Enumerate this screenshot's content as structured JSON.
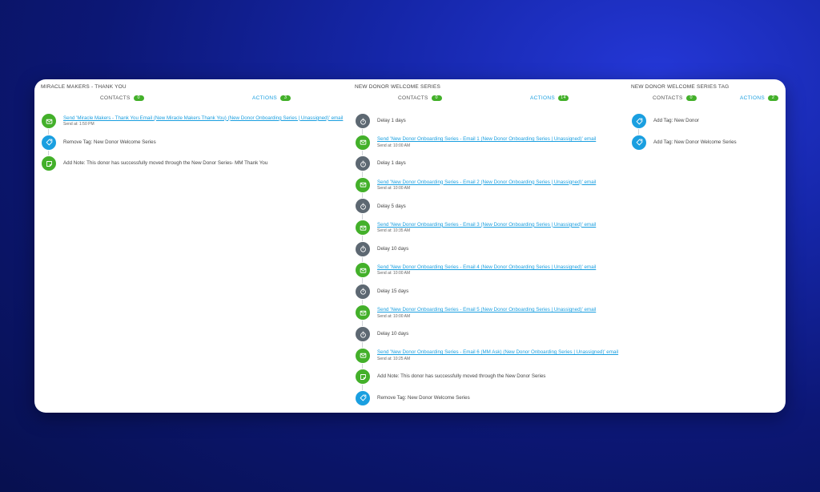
{
  "columns": [
    {
      "title": "MIRACLE MAKERS - THANK YOU",
      "contacts_label": "CONTACTS",
      "contacts_count": "0",
      "actions_label": "ACTIONS",
      "actions_count": "3",
      "steps": [
        {
          "type": "email",
          "icon": "envelope-icon",
          "text": "Send 'Miracle Makers - Thank You Email (New Miracle Makers Thank You) (New Donor Onboarding Series | Unassigned)' email",
          "sub": "Send at: 1:50 PM"
        },
        {
          "type": "tag",
          "icon": "tag-icon",
          "text": "Remove Tag: New Donor Welcome Series"
        },
        {
          "type": "note",
          "icon": "note-icon",
          "text": "Add Note: This donor has successfully moved through the New Donor Series- MM Thank You"
        }
      ]
    },
    {
      "title": "NEW DONOR WELCOME SERIES",
      "contacts_label": "CONTACTS",
      "contacts_count": "0",
      "actions_label": "ACTIONS",
      "actions_count": "14",
      "steps": [
        {
          "type": "delay",
          "icon": "stopwatch-icon",
          "text": "Delay 1 days"
        },
        {
          "type": "email",
          "icon": "envelope-icon",
          "text": "Send 'New Donor Onboarding Series - Email 1 (New Donor Onboarding Series | Unassigned)' email",
          "sub": "Send at: 10:00 AM"
        },
        {
          "type": "delay",
          "icon": "stopwatch-icon",
          "text": "Delay 1 days"
        },
        {
          "type": "email",
          "icon": "envelope-icon",
          "text": "Send 'New Donor Onboarding Series - Email 2 (New Donor Onboarding Series | Unassigned)' email",
          "sub": "Send at: 10:00 AM"
        },
        {
          "type": "delay",
          "icon": "stopwatch-icon",
          "text": "Delay 5 days"
        },
        {
          "type": "email",
          "icon": "envelope-icon",
          "text": "Send 'New Donor Onboarding Series - Email 3 (New Donor Onboarding Series | Unassigned)' email",
          "sub": "Send at: 10:35 AM"
        },
        {
          "type": "delay",
          "icon": "stopwatch-icon",
          "text": "Delay 10 days"
        },
        {
          "type": "email",
          "icon": "envelope-icon",
          "text": "Send 'New Donor Onboarding Series - Email 4 (New Donor Onboarding Series | Unassigned)' email",
          "sub": "Send at: 10:00 AM"
        },
        {
          "type": "delay",
          "icon": "stopwatch-icon",
          "text": "Delay 15 days"
        },
        {
          "type": "email",
          "icon": "envelope-icon",
          "text": "Send 'New Donor Onboarding Series - Email 5 (New Donor Onboarding Series | Unassigned)' email",
          "sub": "Send at: 10:00 AM"
        },
        {
          "type": "delay",
          "icon": "stopwatch-icon",
          "text": "Delay 10 days"
        },
        {
          "type": "email",
          "icon": "envelope-icon",
          "text": "Send 'New Donor Onboarding Series - Email 6 (MM Ask) (New Donor Onboarding Series | Unassigned)' email",
          "sub": "Send at: 10:25 AM"
        },
        {
          "type": "note",
          "icon": "note-icon",
          "text": "Add Note: This donor has successfully moved through the New Donor Series"
        },
        {
          "type": "tag",
          "icon": "tag-icon",
          "text": "Remove Tag: New Donor Welcome Series"
        }
      ]
    },
    {
      "title": "NEW DONOR WELCOME SERIES TAG",
      "contacts_label": "CONTACTS",
      "contacts_count": "0",
      "actions_label": "ACTIONS",
      "actions_count": "2",
      "steps": [
        {
          "type": "tag",
          "icon": "tag-icon",
          "text": "Add Tag: New Donor"
        },
        {
          "type": "tag",
          "icon": "tag-icon",
          "text": "Add Tag: New Donor Welcome Series"
        }
      ]
    }
  ],
  "colors": {
    "email": "#43b02a",
    "tag": "#1a9fe0",
    "note": "#43b02a",
    "delay": "#5d6872",
    "link": "#1a9fe0",
    "badge": "#43b02a"
  }
}
